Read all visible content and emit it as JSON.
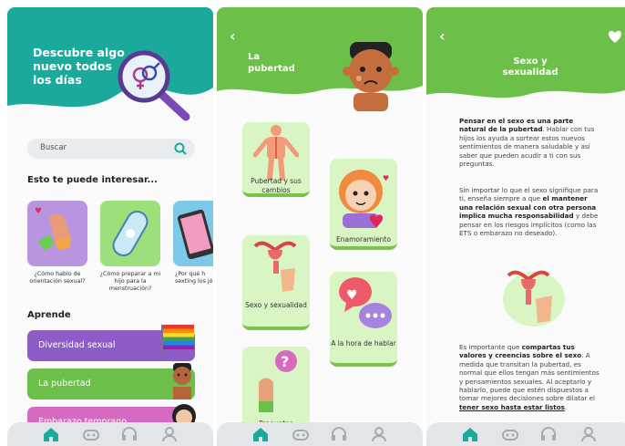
{
  "panel1": {
    "hero_title": "Descubre algo nuevo todos los días",
    "search_placeholder": "Buscar",
    "interest_heading": "Esto te puede interesar...",
    "cards": [
      {
        "caption": "¿Cómo hablo de orientación sexual?"
      },
      {
        "caption": "¿Cómo preparar a mi hijo para la menstruación?"
      },
      {
        "caption": "¿Por qué h sexting los jó"
      }
    ],
    "learn_heading": "Aprende",
    "topics": [
      {
        "label": "Diversidad sexual"
      },
      {
        "label": "La pubertad"
      },
      {
        "label": "Embarazo temprano"
      }
    ]
  },
  "panel2": {
    "back_icon": "chevron-left-icon",
    "title": "La pubertad",
    "cards": [
      {
        "label": "Pubertad y sus cambios"
      },
      {
        "label": "Enamoramiento"
      },
      {
        "label": "Sexo y sexualidad"
      },
      {
        "label": "A la hora de hablar"
      },
      {
        "label": "Preguntas"
      }
    ]
  },
  "panel3": {
    "title": "Sexo y sexualidad",
    "heart_icon": "heart-icon",
    "p1_b1": "Pensar en el sexo es una parte natural de la pubertad",
    "p1_t1": ". Hablar con tus hijos los ayuda a sortear estos nuevos  sentimientos de manera saludable y así saber que pueden acudir a ti con sus preguntas.",
    "p2_t1": "Sin importar lo que el sexo signifique para ti, enseña siempre a que ",
    "p2_b1": "el mantener una relación sexual con otra persona implica mucha responsabilidad",
    "p2_t2": " y debe pensar en los riesgos implícitos (como las ETS o embarazo no deseado).",
    "p3_t1": "Es importante que ",
    "p3_b1": "compartas tus valores y creencias sobre el sexo",
    "p3_t2": ". A medida que transitan la pubertad, es normal que ellos tengan más sentimientos y pensamientos sexuales. Al aceptarlo y hablarlo, puede que estén dispuestos a tomar mejores decisiones sobre dilatar el ",
    "p3_b2": "tener sexo hasta estar listos",
    "p3_t3": "."
  },
  "navbar": {
    "icons": [
      "home-icon",
      "game-controller-icon",
      "headset-icon",
      "user-icon"
    ]
  },
  "colors": {
    "teal": "#1aa99a",
    "green": "#6cc04a",
    "purple": "#8e5cc7",
    "pink": "#d66ac0"
  }
}
